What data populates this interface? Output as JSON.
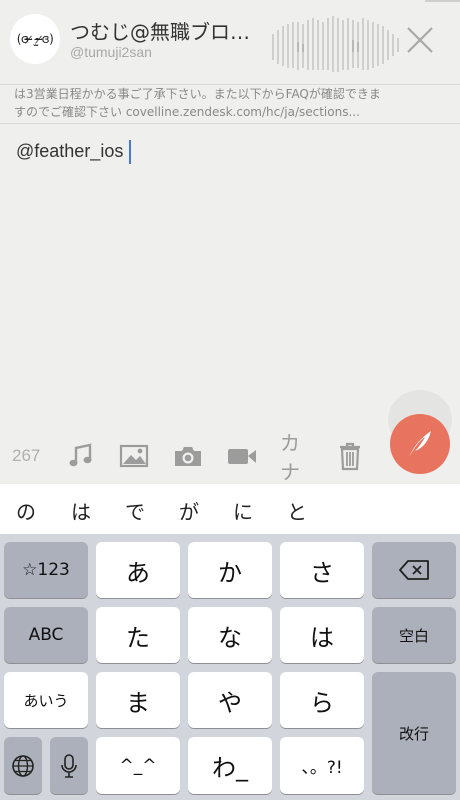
{
  "header": {
    "avatar_text": "(ɞ ̴̶̷ ·̫ ̴̶̷ɞ)",
    "display_name": "つむじ@無職ブロ…",
    "handle": "@tumuji2san"
  },
  "quote": {
    "line1": "は3営業日程かかる事ご了承下さい。また以下からFAQが確認できま",
    "line2": "すのでご確認下さい covelline.zendesk.com/hc/ja/sections..."
  },
  "compose": {
    "text": "@feather_ios"
  },
  "toolbar": {
    "char_count": "267",
    "icons": [
      "music-icon",
      "image-icon",
      "camera-icon",
      "video-icon",
      "katakana-icon",
      "trash-icon"
    ],
    "kana_label": "カナ"
  },
  "suggestions": [
    "の",
    "は",
    "で",
    "が",
    "に",
    "と"
  ],
  "keyboard": {
    "mode_numbers": "☆123",
    "mode_abc": "ABC",
    "mode_kana": "あいう",
    "kana_row1": [
      "あ",
      "か",
      "さ"
    ],
    "kana_row2": [
      "た",
      "な",
      "は"
    ],
    "kana_row3": [
      "ま",
      "や",
      "ら"
    ],
    "kana_row4": [
      "^_^",
      "わ_",
      "、。?!"
    ],
    "space_label": "空白",
    "enter_label": "改行"
  },
  "colors": {
    "background": "#eff0ed",
    "send_button": "#e8735f",
    "caret": "#4a78d6",
    "keyboard_bg": "#d2d5db",
    "key_dark": "#abb0ba"
  }
}
